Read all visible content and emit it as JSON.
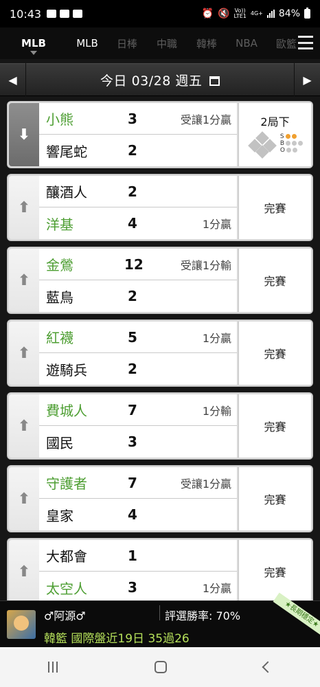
{
  "status_bar": {
    "time": "10:43",
    "battery": "84%",
    "network_top": "Vo))",
    "network_bottom": "LTE1",
    "signal_type": "4G+"
  },
  "tabs": [
    {
      "label": "MLB",
      "active": true
    },
    {
      "label": "MLB"
    },
    {
      "label": "日棒"
    },
    {
      "label": "中職"
    },
    {
      "label": "韓棒"
    },
    {
      "label": "NBA"
    },
    {
      "label": "歐籃"
    }
  ],
  "date_bar": {
    "label": "今日 03/28 週五"
  },
  "games": [
    {
      "expanded": true,
      "teams": [
        {
          "name": "小熊",
          "score": "3",
          "odds": "受讓1分贏",
          "winner": true
        },
        {
          "name": "響尾蛇",
          "score": "2",
          "odds": "",
          "winner": false
        }
      ],
      "status": "2局下",
      "live": true,
      "sbo_labels": [
        "S",
        "B",
        "O"
      ]
    },
    {
      "teams": [
        {
          "name": "釀酒人",
          "score": "2",
          "odds": "",
          "winner": false
        },
        {
          "name": "洋基",
          "score": "4",
          "odds": "1分贏",
          "winner": true
        }
      ],
      "status": "完賽"
    },
    {
      "teams": [
        {
          "name": "金鶯",
          "score": "12",
          "odds": "受讓1分輸",
          "winner": true
        },
        {
          "name": "藍鳥",
          "score": "2",
          "odds": "",
          "winner": false
        }
      ],
      "status": "完賽"
    },
    {
      "teams": [
        {
          "name": "紅襪",
          "score": "5",
          "odds": "1分贏",
          "winner": true
        },
        {
          "name": "遊騎兵",
          "score": "2",
          "odds": "",
          "winner": false
        }
      ],
      "status": "完賽"
    },
    {
      "teams": [
        {
          "name": "費城人",
          "score": "7",
          "odds": "1分輸",
          "winner": true
        },
        {
          "name": "國民",
          "score": "3",
          "odds": "",
          "winner": false
        }
      ],
      "status": "完賽"
    },
    {
      "teams": [
        {
          "name": "守護者",
          "score": "7",
          "odds": "受讓1分贏",
          "winner": true
        },
        {
          "name": "皇家",
          "score": "4",
          "odds": "",
          "winner": false
        }
      ],
      "status": "完賽"
    },
    {
      "teams": [
        {
          "name": "大都會",
          "score": "1",
          "odds": "",
          "winner": false
        },
        {
          "name": "太空人",
          "score": "3",
          "odds": "1分贏",
          "winner": true
        }
      ],
      "status": "完賽"
    }
  ],
  "banner": {
    "user": "♂阿源♂",
    "rate": "評選勝率: 70%",
    "line": "韓籃 國際盤近19日 35過26",
    "ribbon": "★長期穩定★"
  },
  "colors": {
    "win_green": "#4d9e32",
    "banner_green": "#b5e05a",
    "sbo_on": "#f0a030"
  }
}
